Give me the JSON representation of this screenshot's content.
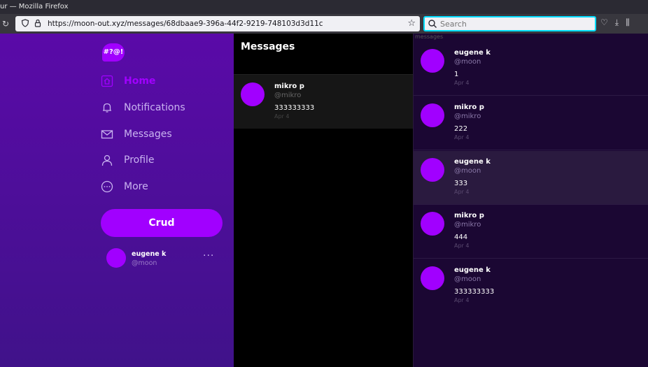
{
  "browser": {
    "window_title": "ur — Mozilla Firefox",
    "url": "https://moon-out.xyz/messages/68dbaae9-396a-44f2-9219-748103d3d11c",
    "search_placeholder": "Search"
  },
  "sidebar": {
    "logo": "#?@!",
    "items": [
      {
        "label": "Home",
        "icon": "home-icon",
        "active": true
      },
      {
        "label": "Notifications",
        "icon": "bell-icon",
        "active": false
      },
      {
        "label": "Messages",
        "icon": "envelope-icon",
        "active": false
      },
      {
        "label": "Profile",
        "icon": "user-icon",
        "active": false
      },
      {
        "label": "More",
        "icon": "more-circle-icon",
        "active": false
      }
    ],
    "crud_button": "Crud",
    "user": {
      "name": "eugene k",
      "handle": "@moon",
      "more": "···"
    }
  },
  "conversations": {
    "header": "Messages",
    "items": [
      {
        "name": "mikro p",
        "handle": "@mikro",
        "text": "333333333",
        "date": "Apr 4"
      }
    ]
  },
  "thread": {
    "label": "messages",
    "messages": [
      {
        "name": "eugene k",
        "handle": "@moon",
        "text": "1",
        "date": "Apr 4"
      },
      {
        "name": "mikro p",
        "handle": "@mikro",
        "text": "222",
        "date": "Apr 4"
      },
      {
        "name": "eugene k",
        "handle": "@moon",
        "text": "333",
        "date": "Apr 4"
      },
      {
        "name": "mikro p",
        "handle": "@mikro",
        "text": "444",
        "date": "Apr 4"
      },
      {
        "name": "eugene k",
        "handle": "@moon",
        "text": "333333333",
        "date": "Apr 4"
      }
    ]
  },
  "colors": {
    "accent": "#a100ff",
    "sidebar_top": "#5a0aa8",
    "sidebar_bottom": "#40128a",
    "thread_bg": "#1b0733"
  }
}
